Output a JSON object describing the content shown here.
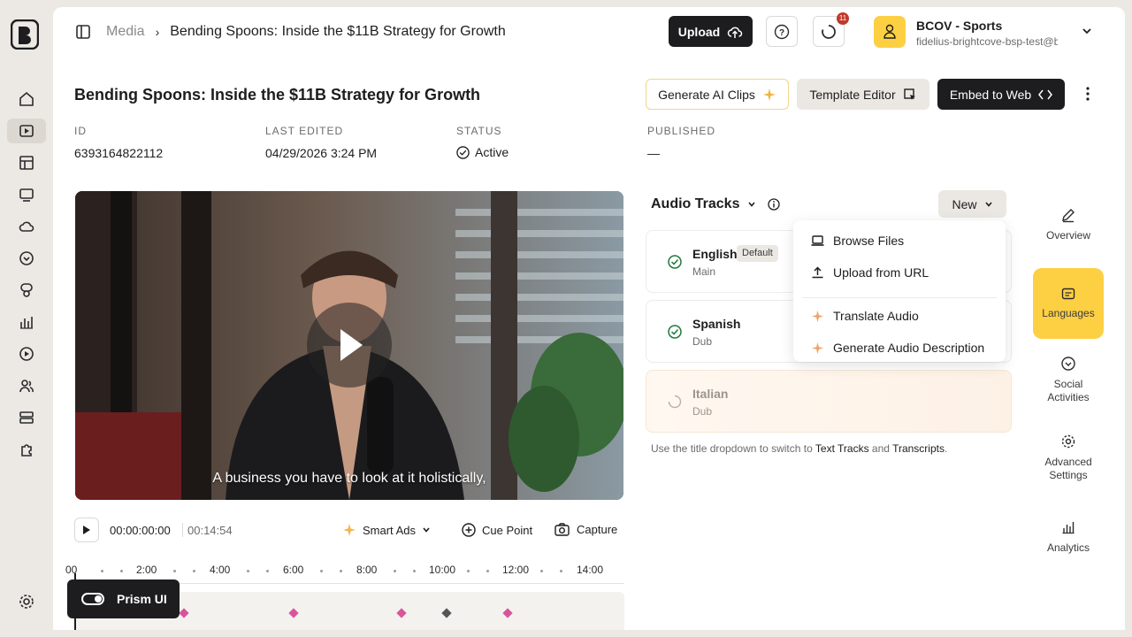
{
  "header": {
    "breadcrumb_root": "Media",
    "breadcrumb_current": "Bending Spoons: Inside the $11B Strategy for Growth",
    "upload_label": "Upload",
    "notification_count": "11",
    "account_name": "BCOV - Sports",
    "account_email": "fidelius-brightcove-bsp-test@b..."
  },
  "title": "Bending Spoons: Inside the $11B Strategy for Growth",
  "actions": {
    "generate_ai_clips": "Generate AI Clips",
    "template_editor": "Template Editor",
    "embed_to_web": "Embed to Web"
  },
  "meta": {
    "id_label": "ID",
    "id_value": "6393164822112",
    "edited_label": "LAST EDITED",
    "edited_value": "04/29/2026 3:24 PM",
    "status_label": "STATUS",
    "status_value": "Active",
    "published_label": "PUBLISHED",
    "published_value": "—"
  },
  "video": {
    "caption": "A business you have to look at it holistically,"
  },
  "player": {
    "current_time": "00:00:00:00",
    "duration": "00:14:54",
    "smart_ads": "Smart Ads",
    "cue_point": "Cue Point",
    "capture": "Capture"
  },
  "timeline": {
    "ticks": [
      "00",
      "2:00",
      "4:00",
      "6:00",
      "8:00",
      "10:00",
      "12:00",
      "14:00"
    ]
  },
  "prism": {
    "label": "Prism UI"
  },
  "audio": {
    "heading": "Audio Tracks",
    "new_label": "New",
    "tracks": [
      {
        "name": "English",
        "badge": "Default",
        "sub": "Main"
      },
      {
        "name": "Spanish",
        "sub": "Dub"
      },
      {
        "name": "Italian",
        "sub": "Dub"
      }
    ],
    "hint_prefix": "Use the title dropdown to switch to ",
    "hint_link1": "Text Tracks",
    "hint_mid": " and ",
    "hint_link2": "Transcripts",
    "hint_suffix": "."
  },
  "menu": {
    "items": [
      "Browse Files",
      "Upload from URL",
      "Translate Audio",
      "Generate Audio Description"
    ]
  },
  "side_panel": {
    "items": [
      "Overview",
      "Languages",
      "Social Activities",
      "Advanced Settings",
      "Analytics"
    ]
  },
  "colors": {
    "accent_yellow": "#fdd043",
    "dark_button": "#1d1d1f",
    "success_green": "#1e7a3c",
    "marker_pink": "#d9559a",
    "badge_red": "#c0392b"
  }
}
